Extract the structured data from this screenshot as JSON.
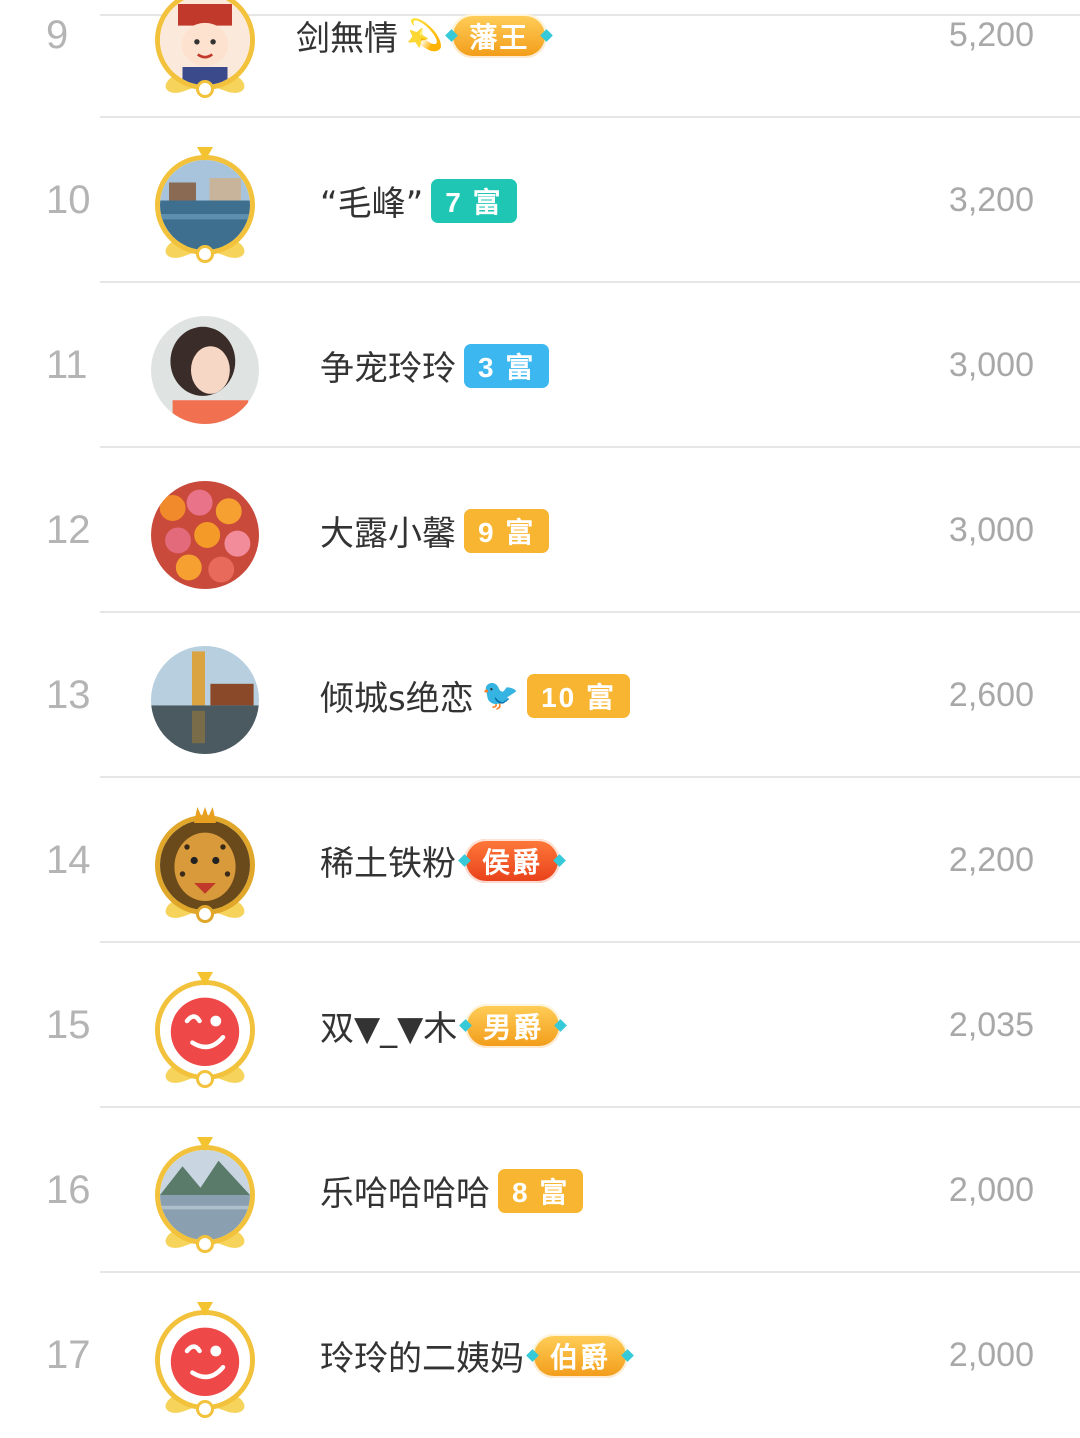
{
  "colors": {
    "teal_badge": "#1fc6b4",
    "blue_badge": "#3db7f0",
    "orange_badge": "#f7b532",
    "red_noble": "#f05a2a",
    "gold_noble": "#f5a623",
    "frame_gold": "#f2c23c",
    "rank_text": "#b4b4b4",
    "amount_text": "#a8a8a8"
  },
  "rows": [
    {
      "rank": "9",
      "name": "剑無情",
      "emoji": "💫",
      "badge": "藩王",
      "badge_style": "noble-gold",
      "amount": "5,200",
      "avatar": "cartoon-boy-avatar",
      "frame": "gold"
    },
    {
      "rank": "10",
      "name": "“毛峰”",
      "emoji": "",
      "badge": "7 富",
      "badge_style": "teal",
      "amount": "3,200",
      "avatar": "river-town-photo",
      "frame": "gold"
    },
    {
      "rank": "11",
      "name": "争宠玲玲",
      "emoji": "",
      "badge": "3 富",
      "badge_style": "blue",
      "amount": "3,000",
      "avatar": "woman-portrait-photo",
      "frame": "none"
    },
    {
      "rank": "12",
      "name": "大露小馨",
      "emoji": "",
      "badge": "9 富",
      "badge_style": "orange",
      "amount": "3,000",
      "avatar": "fruit-stall-photo",
      "frame": "none"
    },
    {
      "rank": "13",
      "name": "倾城s绝恋",
      "emoji": "🐦",
      "badge": "10 富",
      "badge_style": "orange",
      "amount": "2,600",
      "avatar": "pagoda-lake-photo",
      "frame": "none"
    },
    {
      "rank": "14",
      "name": "稀土铁粉",
      "emoji": "",
      "badge": "侯爵",
      "badge_style": "noble-red",
      "amount": "2,200",
      "avatar": "leopard-avatar",
      "frame": "crown"
    },
    {
      "rank": "15",
      "name": "双▼_▼木",
      "emoji": "",
      "badge": "男爵",
      "badge_style": "noble-gold",
      "amount": "2,035",
      "avatar": "winking-face-avatar",
      "frame": "gold"
    },
    {
      "rank": "16",
      "name": "乐哈哈哈哈",
      "emoji": "",
      "badge": "8 富",
      "badge_style": "orange",
      "amount": "2,000",
      "avatar": "mountain-river-photo",
      "frame": "gold"
    },
    {
      "rank": "17",
      "name": "玲玲的二姨妈",
      "emoji": "",
      "badge": "伯爵",
      "badge_style": "noble-gold",
      "amount": "2,000",
      "avatar": "winking-face-avatar",
      "frame": "gold"
    }
  ]
}
